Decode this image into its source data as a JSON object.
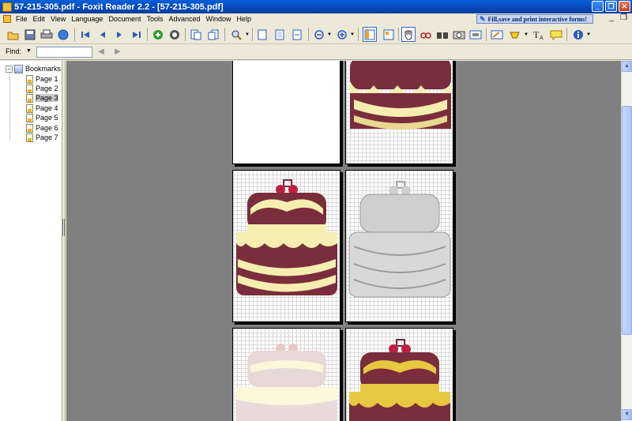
{
  "window": {
    "title": "57-215-305.pdf - Foxit Reader 2.2 - [57-215-305.pdf]",
    "minimize": "_",
    "maximize": "❐",
    "close": "✕"
  },
  "menu": {
    "items": [
      "File",
      "Edit",
      "View",
      "Language",
      "Document",
      "Tools",
      "Advanced",
      "Window",
      "Help"
    ],
    "promo": "Fill,save and print interactive forms!",
    "mdi_minimize": "_",
    "mdi_restore": "❐"
  },
  "toolbar": {
    "icons": [
      "open-icon",
      "save-icon",
      "print-icon",
      "email-icon",
      "first-page-icon",
      "previous-page-icon",
      "next-page-icon",
      "last-page-icon",
      "go-back-icon",
      "go-forward-icon",
      "rotate-left-icon",
      "rotate-right-icon",
      "zoom-icon",
      "actual-size-icon",
      "fit-page-icon",
      "fit-width-icon",
      "zoom-out-icon",
      "zoom-in-icon",
      "bookmark-view-icon",
      "thumbnail-view-icon",
      "hand-tool-icon",
      "select-text-icon",
      "find-icon",
      "snapshot-icon",
      "image-select-icon",
      "typewriter-icon",
      "highlight-icon",
      "text-tool-icon",
      "note-icon",
      "info-icon"
    ]
  },
  "find": {
    "label": "Find:",
    "value": "",
    "placeholder": ""
  },
  "bookmarks": {
    "root": "Bookmarks",
    "pages": [
      "Page 1",
      "Page 2",
      "Page 3",
      "Page 4",
      "Page 5",
      "Page 6",
      "Page 7"
    ],
    "selected": "Page 3"
  },
  "colors": {
    "cake_dark": "#7a2d3a",
    "cake_cream": "#f5eeb0",
    "cake_tan": "#b08a6a",
    "viewer_bg": "#808080",
    "titlebar": "#0a5fd8"
  }
}
